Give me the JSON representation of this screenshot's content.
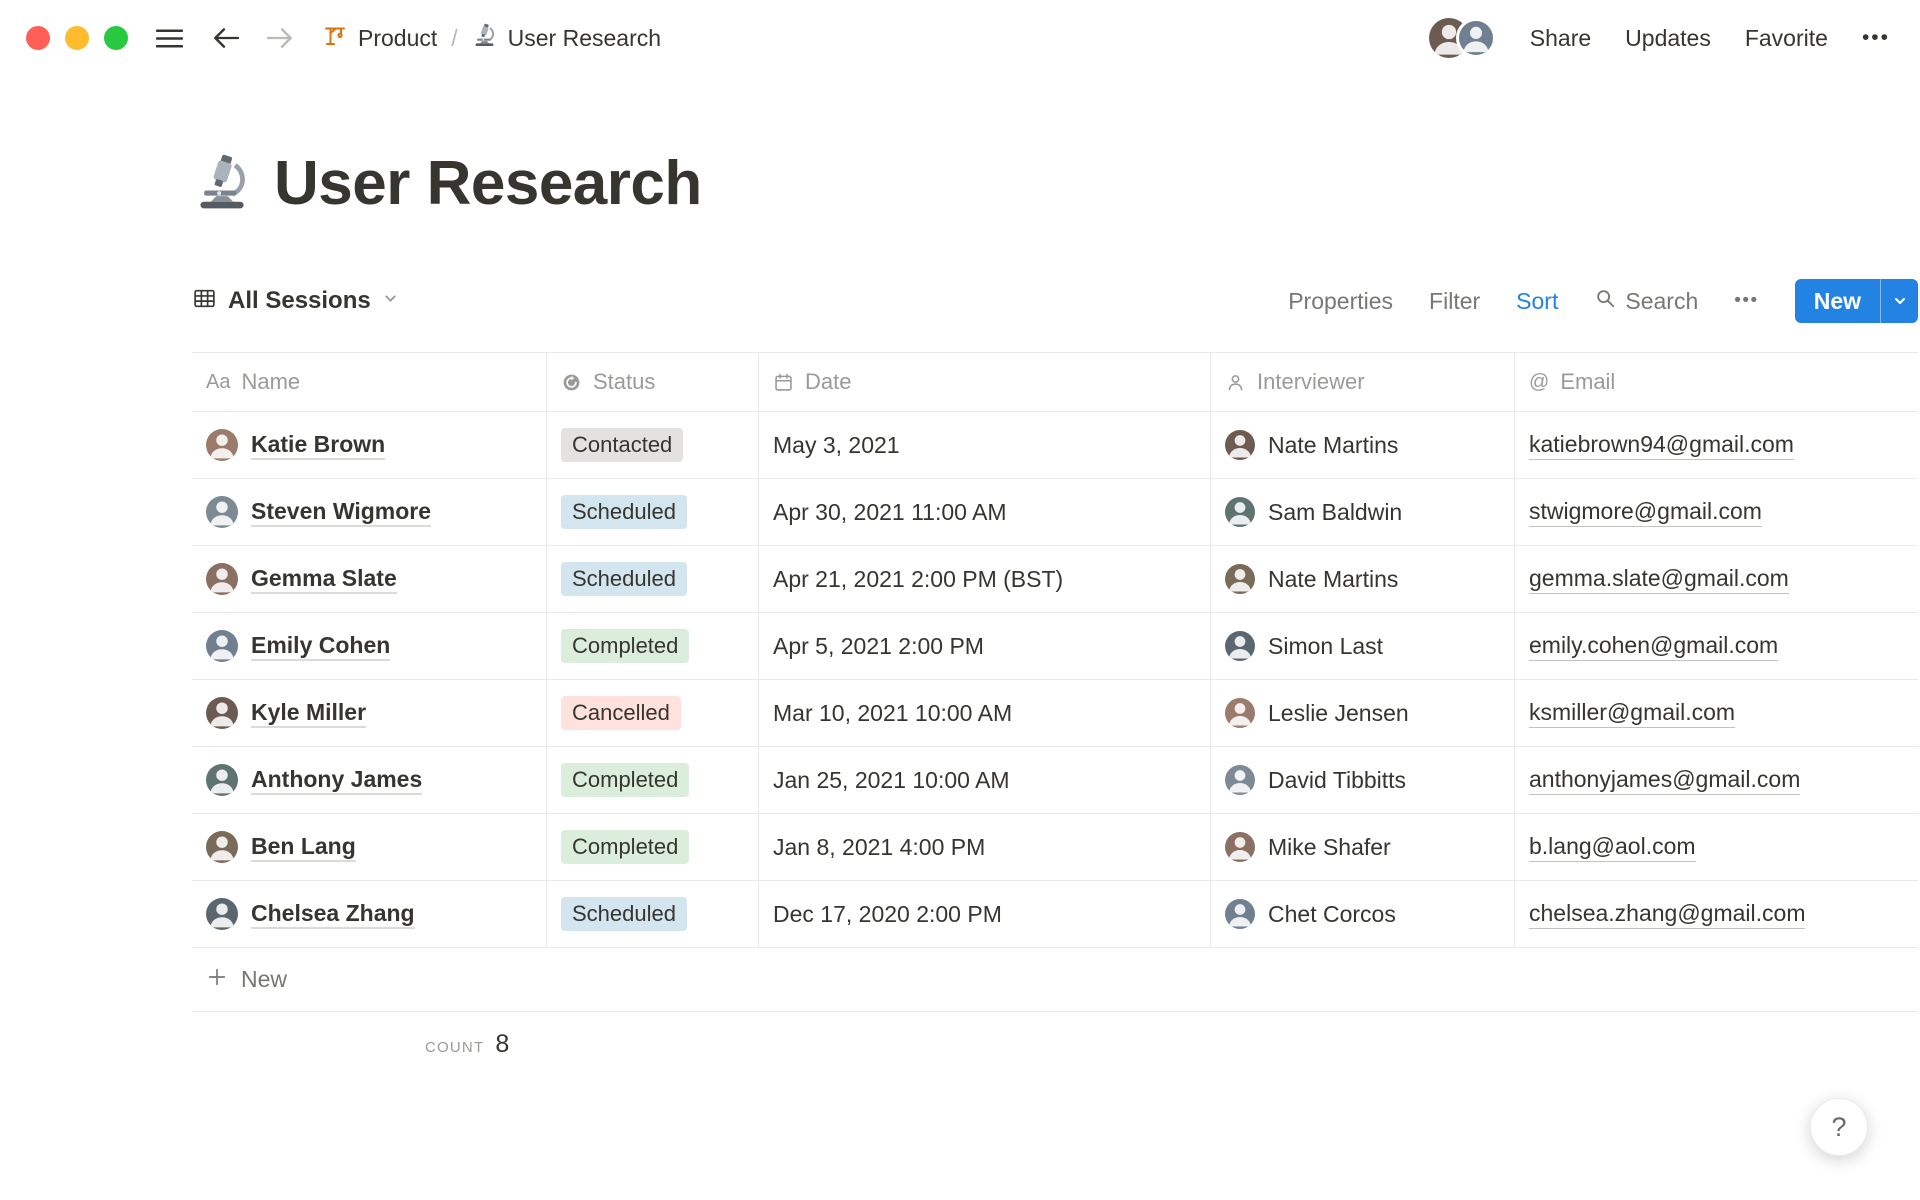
{
  "topbar": {
    "breadcrumb": {
      "product": "Product",
      "separator": "/",
      "page": "User Research"
    },
    "share": "Share",
    "updates": "Updates",
    "favorite": "Favorite",
    "more": "•••"
  },
  "page": {
    "title": "User Research"
  },
  "view_bar": {
    "view_name": "All Sessions",
    "properties": "Properties",
    "filter": "Filter",
    "sort": "Sort",
    "search": "Search",
    "more": "•••",
    "new": "New"
  },
  "icons": {
    "name_type": "Aa",
    "email_at": "@"
  },
  "table": {
    "columns": [
      {
        "label": "Name"
      },
      {
        "label": "Status"
      },
      {
        "label": "Date"
      },
      {
        "label": "Interviewer"
      },
      {
        "label": "Email"
      }
    ],
    "rows": [
      {
        "name": "Katie Brown",
        "status": "Contacted",
        "date": "May 3, 2021",
        "interviewer": "Nate Martins",
        "email": "katiebrown94@gmail.com"
      },
      {
        "name": "Steven Wigmore",
        "status": "Scheduled",
        "date": "Apr 30, 2021 11:00 AM",
        "interviewer": "Sam Baldwin",
        "email": "stwigmore@gmail.com"
      },
      {
        "name": "Gemma Slate",
        "status": "Scheduled",
        "date": "Apr 21, 2021 2:00 PM (BST)",
        "interviewer": "Nate Martins",
        "email": "gemma.slate@gmail.com"
      },
      {
        "name": "Emily Cohen",
        "status": "Completed",
        "date": "Apr 5, 2021 2:00 PM",
        "interviewer": "Simon Last",
        "email": "emily.cohen@gmail.com"
      },
      {
        "name": "Kyle Miller",
        "status": "Cancelled",
        "date": "Mar 10, 2021 10:00 AM",
        "interviewer": "Leslie Jensen",
        "email": "ksmiller@gmail.com"
      },
      {
        "name": "Anthony James",
        "status": "Completed",
        "date": "Jan 25, 2021 10:00 AM",
        "interviewer": "David Tibbitts",
        "email": "anthonyjames@gmail.com"
      },
      {
        "name": "Ben Lang",
        "status": "Completed",
        "date": "Jan 8, 2021 4:00 PM",
        "interviewer": "Mike Shafer",
        "email": "b.lang@aol.com"
      },
      {
        "name": "Chelsea Zhang",
        "status": "Scheduled",
        "date": "Dec 17, 2020 2:00 PM",
        "interviewer": "Chet Corcos",
        "email": "chelsea.zhang@gmail.com"
      }
    ],
    "status_colors": {
      "Contacted": "#e3e2e0",
      "Scheduled": "#d3e5ef",
      "Completed": "#dbeddb",
      "Cancelled": "#ffe2dd"
    },
    "new_row": "New",
    "count_label": "COUNT",
    "count_value": "8"
  },
  "help": "?",
  "accent_color": "#2383e2"
}
